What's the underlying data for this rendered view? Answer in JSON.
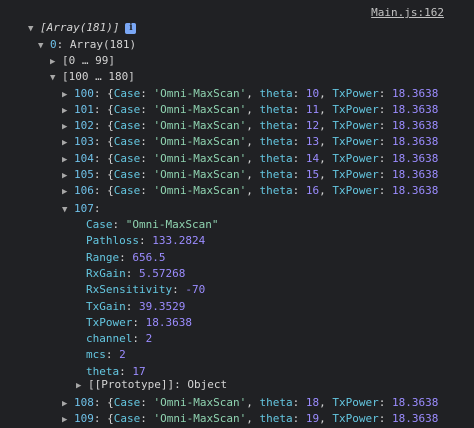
{
  "console": {
    "source_link": "Main.js:162",
    "header": "[Array(181)]",
    "info_glyph": "i",
    "root": {
      "key": "0",
      "summary": "Array(181)"
    },
    "ranges": [
      "[0 … 99]",
      "[100 … 180]"
    ],
    "collapsed_rows": [
      {
        "index": "100",
        "case": "'Omni-MaxScan'",
        "theta": "10",
        "txpower": "18.3638"
      },
      {
        "index": "101",
        "case": "'Omni-MaxScan'",
        "theta": "11",
        "txpower": "18.3638"
      },
      {
        "index": "102",
        "case": "'Omni-MaxScan'",
        "theta": "12",
        "txpower": "18.3638"
      },
      {
        "index": "103",
        "case": "'Omni-MaxScan'",
        "theta": "13",
        "txpower": "18.3638"
      },
      {
        "index": "104",
        "case": "'Omni-MaxScan'",
        "theta": "14",
        "txpower": "18.3638"
      },
      {
        "index": "105",
        "case": "'Omni-MaxScan'",
        "theta": "15",
        "txpower": "18.3638"
      },
      {
        "index": "106",
        "case": "'Omni-MaxScan'",
        "theta": "16",
        "txpower": "18.3638"
      }
    ],
    "expanded": {
      "index": "107",
      "fields": [
        {
          "key": "Case",
          "value": "\"Omni-MaxScan\"",
          "type": "string"
        },
        {
          "key": "Pathloss",
          "value": "133.2824",
          "type": "number"
        },
        {
          "key": "Range",
          "value": "656.5",
          "type": "number"
        },
        {
          "key": "RxGain",
          "value": "5.57268",
          "type": "number"
        },
        {
          "key": "RxSensitivity",
          "value": "-70",
          "type": "number"
        },
        {
          "key": "TxGain",
          "value": "39.3529",
          "type": "number"
        },
        {
          "key": "TxPower",
          "value": "18.3638",
          "type": "number"
        },
        {
          "key": "channel",
          "value": "2",
          "type": "number"
        },
        {
          "key": "mcs",
          "value": "2",
          "type": "number"
        },
        {
          "key": "theta",
          "value": "17",
          "type": "number"
        }
      ],
      "prototype_label": "[[Prototype]]",
      "prototype_value": "Object"
    },
    "tail_rows": [
      {
        "index": "108",
        "case": "'Omni-MaxScan'",
        "theta": "18",
        "txpower": "18.3638"
      },
      {
        "index": "109",
        "case": "'Omni-MaxScan'",
        "theta": "19",
        "txpower": "18.3638"
      }
    ],
    "labels": {
      "case": "Case",
      "theta": "theta",
      "txpower": "TxPower"
    }
  }
}
